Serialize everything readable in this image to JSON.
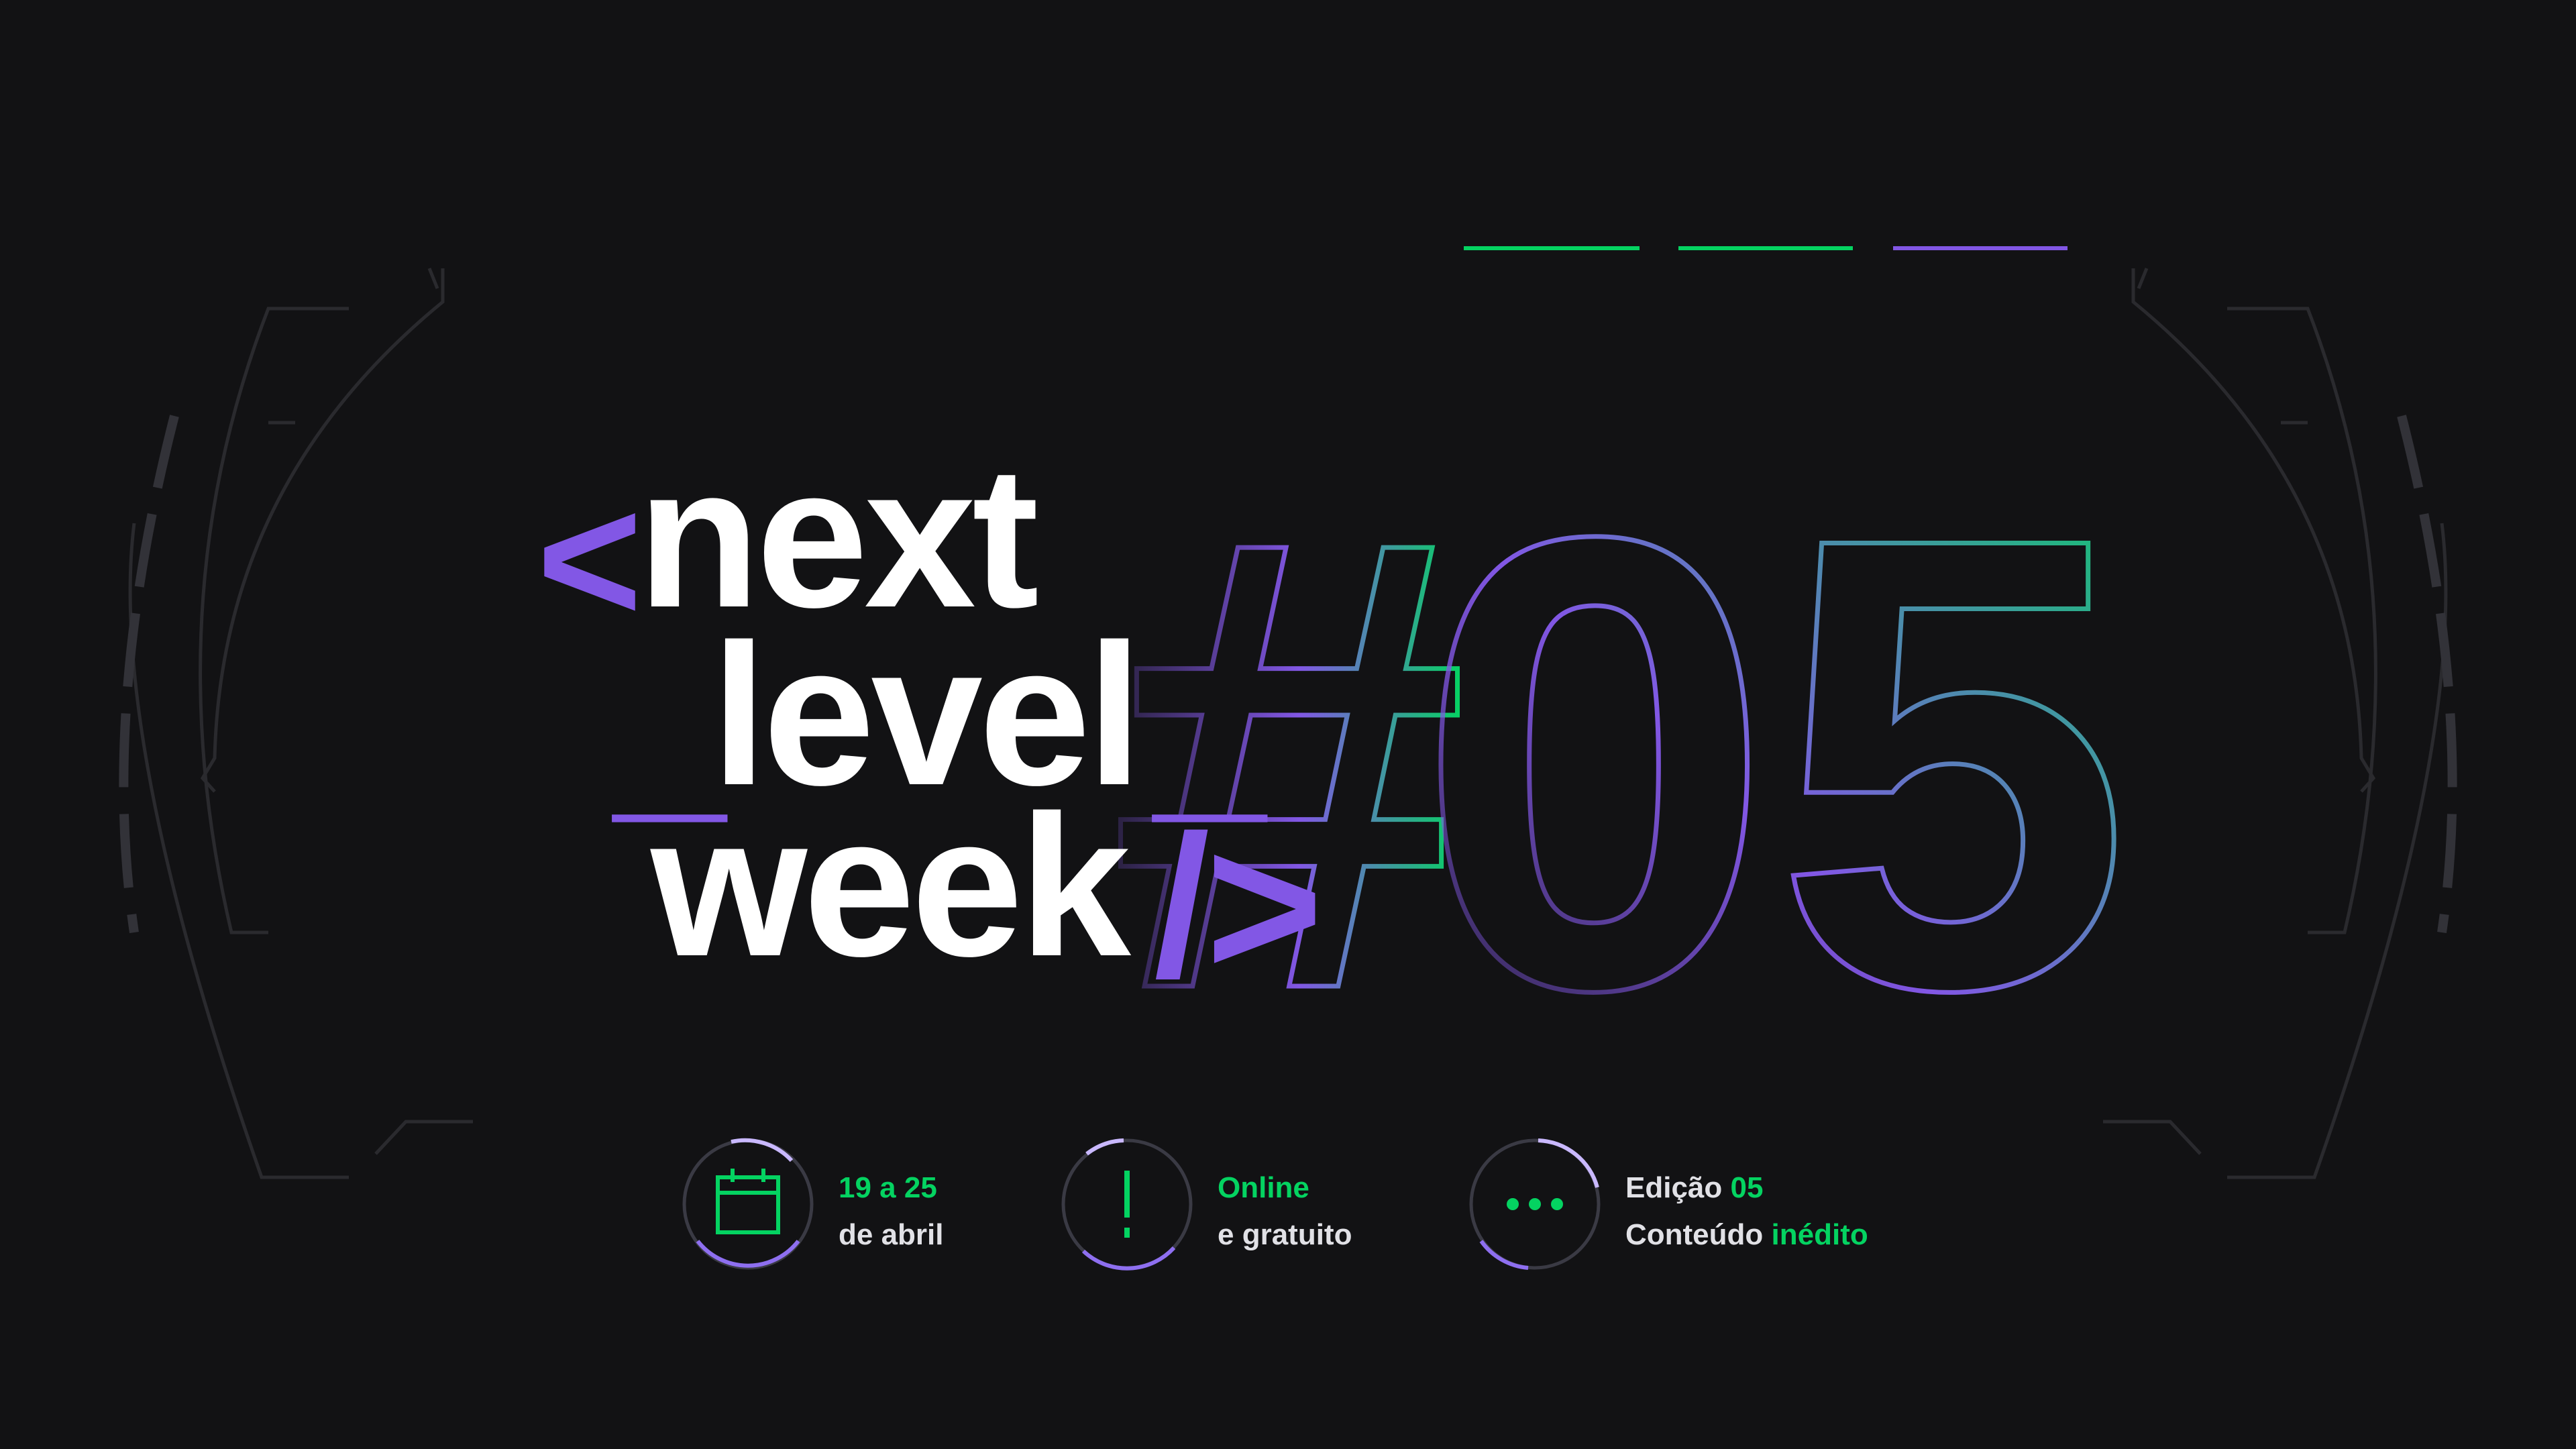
{
  "title": {
    "open_bracket": "<",
    "line1": "next",
    "line2_prefix": "_",
    "line2": "level",
    "line2_suffix": "_",
    "line3": "week",
    "close_bracket": "/>",
    "edition_mark": "#05"
  },
  "info": [
    {
      "icon": "calendar-icon",
      "line1": "19 a 25",
      "line2": "de abril"
    },
    {
      "icon": "exclamation-icon",
      "line1": "Online",
      "line2": "e gratuito"
    },
    {
      "icon": "ellipsis-icon",
      "line1_a": "Edição ",
      "line1_b": "05",
      "line2_a": "Conteúdo ",
      "line2_b": "inédito"
    }
  ],
  "colors": {
    "background": "#121214",
    "purple": "#8257e5",
    "green": "#04d361",
    "text": "#e1e1e6"
  }
}
